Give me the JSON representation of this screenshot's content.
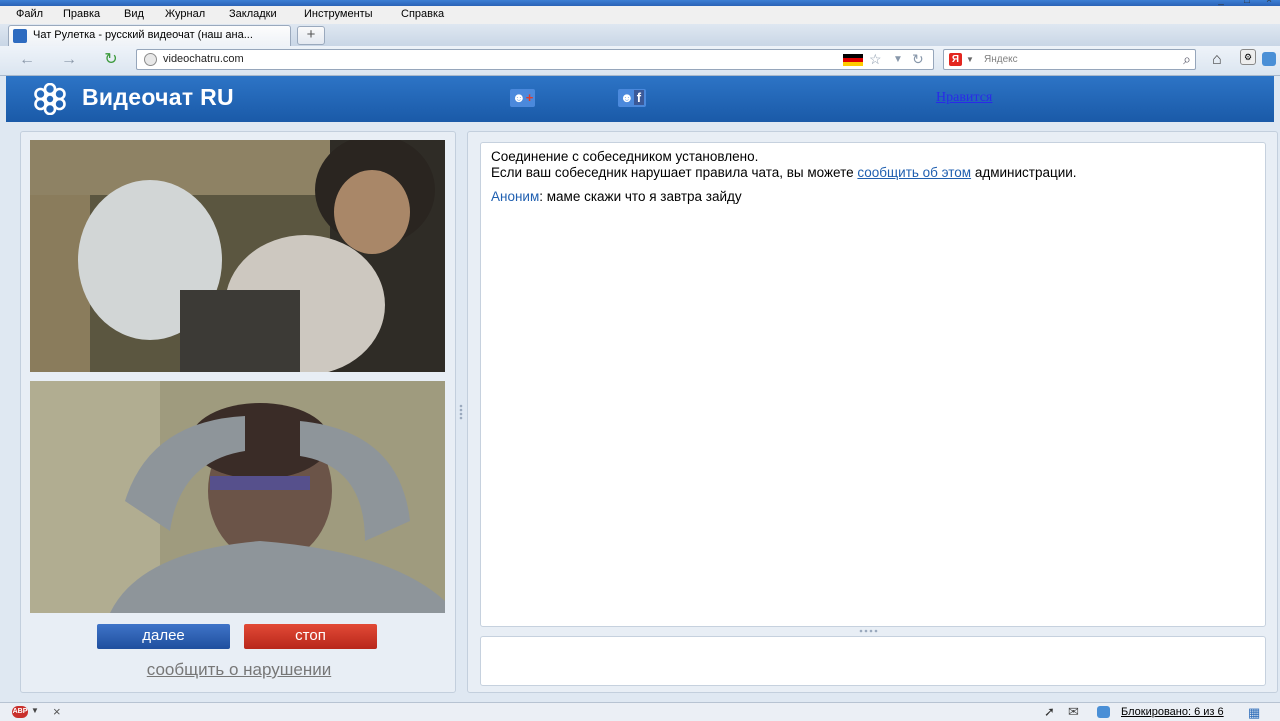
{
  "browser": {
    "menu": [
      "Файл",
      "Правка",
      "Вид",
      "Журнал",
      "Закладки",
      "Инструменты",
      "Справка"
    ],
    "tab_title": "Чат Рулетка - русский видеочат (наш ана...",
    "new_tab_label": "+",
    "url": "videochatru.com",
    "search_placeholder": "Яндекс",
    "search_engine_letter": "Я",
    "status_blocked": "Блокировано: 6 из 6",
    "status_close": "×",
    "abp_label": "ABP"
  },
  "site": {
    "logo_text": "Видеочат RU",
    "google_plus_label": "+",
    "facebook_label": "f",
    "like_label": "Нравится",
    "next_button": "далее",
    "stop_button": "стоп",
    "report_link": "сообщить о нарушении",
    "colors": {
      "header": "#1f63b2",
      "next": "#2f63b8",
      "stop": "#d13a2a"
    }
  },
  "chat": {
    "system_line1": "Соединение с собеседником установлено.",
    "system_line2_prefix": "Если ваш собеседник нарушает правила чата, вы можете ",
    "system_line2_link": "сообщить об этом",
    "system_line2_suffix": " администрации.",
    "message_author": "Аноним",
    "message_sep": ": ",
    "message_text": "маме скажи что я завтра зайду"
  }
}
